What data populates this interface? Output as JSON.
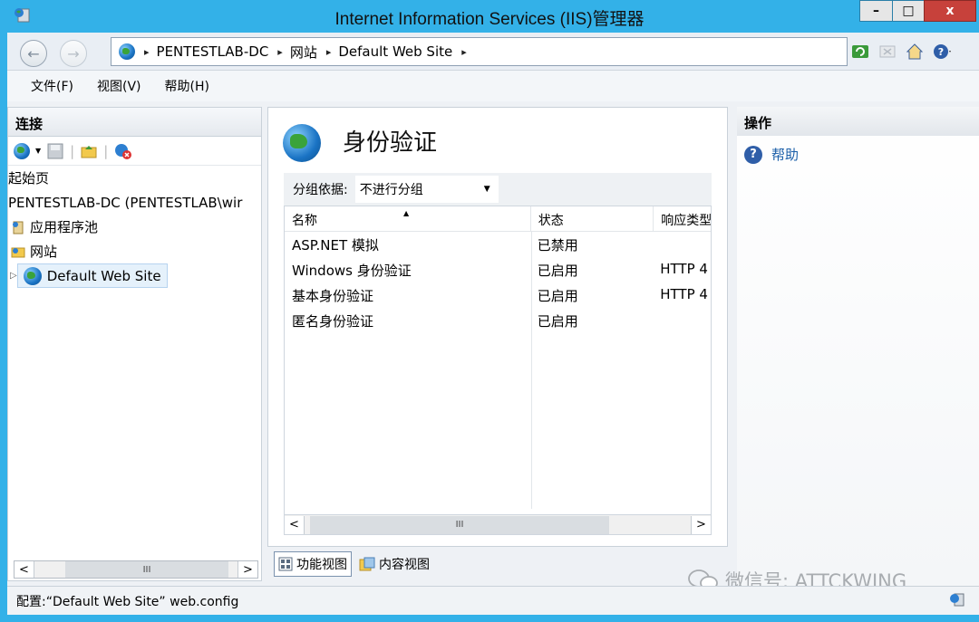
{
  "window": {
    "title": "Internet Information Services (IIS)管理器",
    "controls": {
      "minimize": "–",
      "maximize": "□",
      "close": "x"
    }
  },
  "address_bar": {
    "crumbs": [
      "PENTESTLAB-DC",
      "网站",
      "Default Web Site"
    ],
    "separator": "▸"
  },
  "menu": [
    "文件(F)",
    "视图(V)",
    "帮助(H)"
  ],
  "connections": {
    "header": "连接",
    "tree": [
      {
        "label": "起始页",
        "icon": "start-page-icon"
      },
      {
        "label": "PENTESTLAB-DC (PENTESTLAB\\wir",
        "icon": "server-icon"
      },
      {
        "label": "应用程序池",
        "icon": "app-pool-icon"
      },
      {
        "label": "网站",
        "icon": "sites-folder-icon"
      },
      {
        "label": "Default Web Site",
        "icon": "globe-icon",
        "selected": true
      }
    ],
    "scroll_center": "III"
  },
  "feature": {
    "title": "身份验证",
    "group_by_label": "分组依据:",
    "group_by_value": "不进行分组",
    "columns": [
      "名称",
      "状态",
      "响应类型"
    ],
    "rows": [
      {
        "name": "ASP.NET 模拟",
        "status": "已禁用",
        "response": ""
      },
      {
        "name": "Windows 身份验证",
        "status": "已启用",
        "response": "HTTP 4"
      },
      {
        "name": "基本身份验证",
        "status": "已启用",
        "response": "HTTP 4"
      },
      {
        "name": "匿名身份验证",
        "status": "已启用",
        "response": ""
      }
    ],
    "scroll_center": "III"
  },
  "view_tabs": {
    "features": "功能视图",
    "content": "内容视图"
  },
  "actions": {
    "header": "操作",
    "items": [
      {
        "label": "帮助",
        "icon": "help-icon"
      }
    ]
  },
  "status": {
    "text": "配置:“Default Web Site” web.config"
  },
  "watermark": {
    "text": "微信号: ATTCKWING"
  },
  "colors": {
    "titlebar": "#33b1e8",
    "close": "#c7413b",
    "link": "#1a5ea8"
  }
}
